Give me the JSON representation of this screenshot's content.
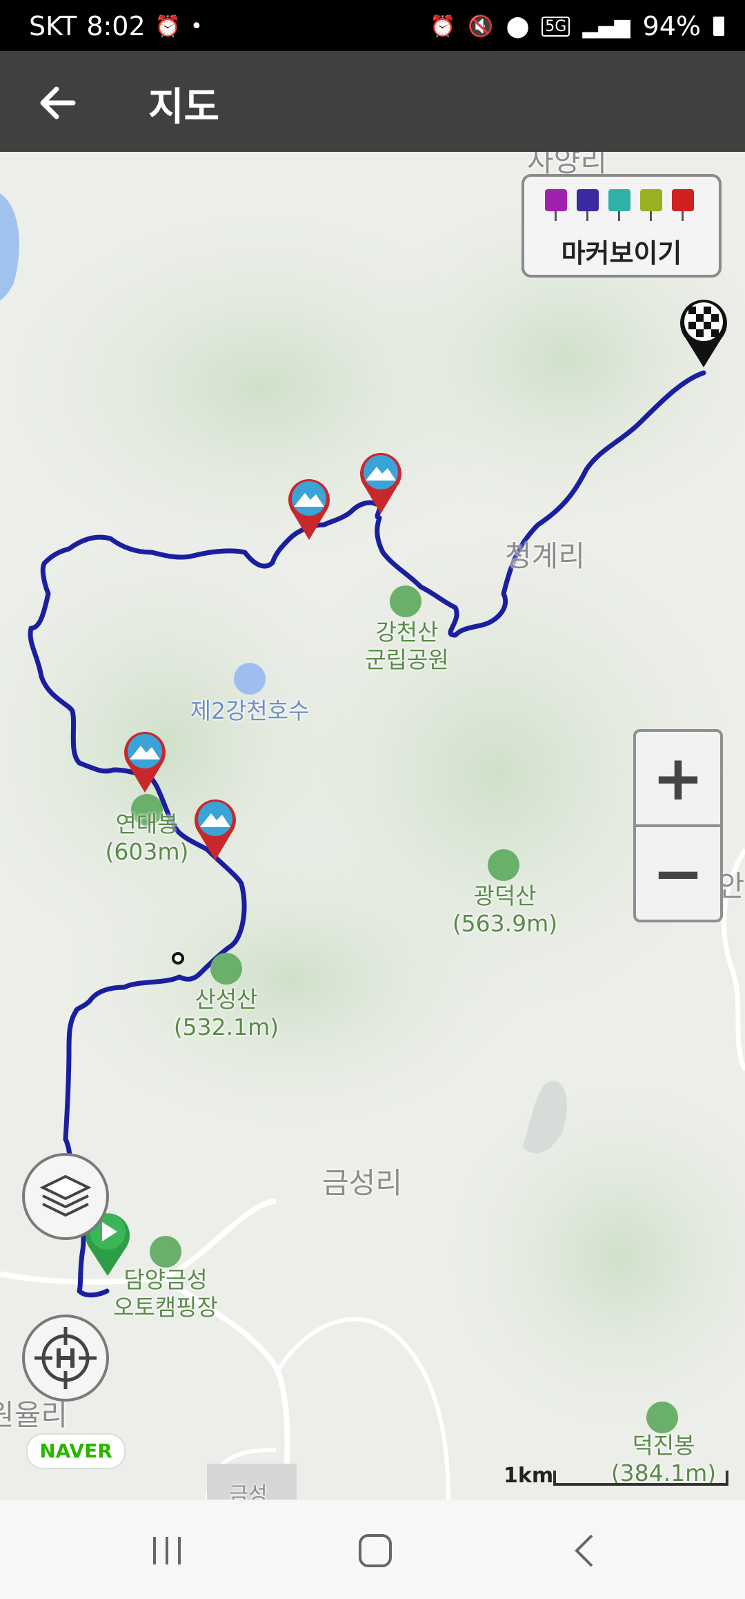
{
  "status_bar": {
    "carrier": "SKT",
    "time": "8:02",
    "battery": "94%",
    "network": "5G",
    "icons": [
      "alarm-icon",
      "mute-icon",
      "location-icon",
      "signal-icon",
      "battery-icon"
    ]
  },
  "app_bar": {
    "title": "지도",
    "back_icon": "arrow-left-icon"
  },
  "map": {
    "marker_toggle": {
      "label": "마커보이기",
      "icon_colors": [
        "#a020b0",
        "#3a2aa0",
        "#2fb0a8",
        "#9ab020",
        "#d02020"
      ]
    },
    "labels": {
      "village_top": "사양리",
      "village_cheonggye": "청계리",
      "village_geumseong": "금성리",
      "village_sangan": "상안리",
      "village_wonyul": "원율리",
      "village_bottom": "금성",
      "park": "강천산\n군립공원",
      "lake": "제2강천호수",
      "peak_yeondae": "연대봉\n(603m)",
      "peak_gwangdeok": "광덕산\n(563.9m)",
      "peak_sanseong": "산성산\n(532.1m)",
      "peak_deokjin": "덕진봉\n(384.1m)",
      "camping": "담양금성\n오토캠핑장"
    },
    "route_color": "#1a1fa0",
    "attribution": "NAVER",
    "scale_label": "1km"
  },
  "controls": {
    "zoom_in": "+",
    "zoom_out": "−"
  }
}
